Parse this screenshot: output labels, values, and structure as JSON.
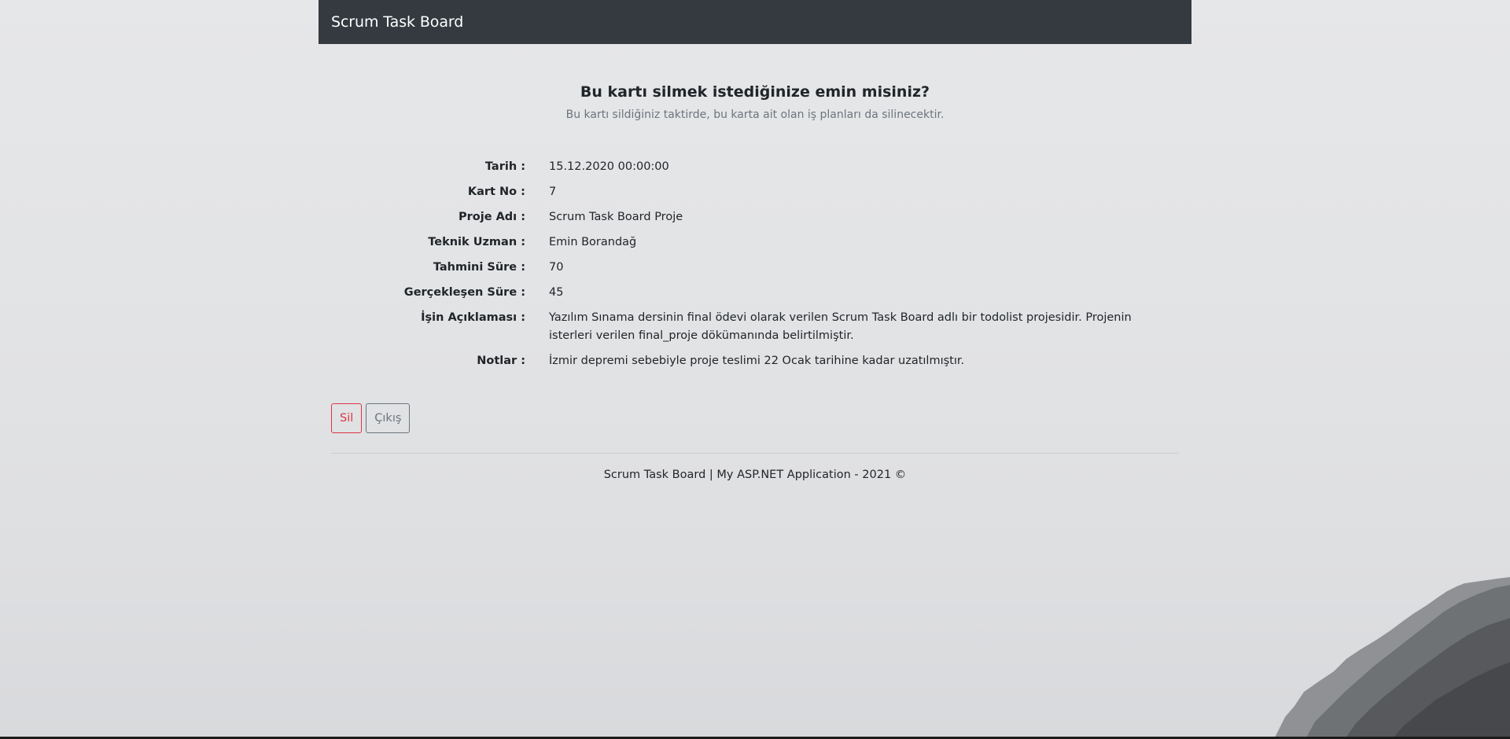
{
  "navbar": {
    "brand": "Scrum Task Board"
  },
  "confirm": {
    "title": "Bu kartı silmek istediğinize emin misiniz?",
    "subtitle": "Bu kartı sildiğiniz taktirde, bu karta ait olan iş planları da silinecektir."
  },
  "details": [
    {
      "label": "Tarih :",
      "value": "15.12.2020 00:00:00"
    },
    {
      "label": "Kart No :",
      "value": "7"
    },
    {
      "label": "Proje Adı :",
      "value": "Scrum Task Board Proje"
    },
    {
      "label": "Teknik Uzman :",
      "value": "Emin Borandağ"
    },
    {
      "label": "Tahmini Süre :",
      "value": "70"
    },
    {
      "label": "Gerçekleşen Süre :",
      "value": "45"
    },
    {
      "label": "İşin Açıklaması :",
      "value": "Yazılım Sınama dersinin final ödevi olarak verilen Scrum Task Board adlı bir todolist projesidir. Projenin isterleri verilen final_proje dökümanında belirtilmiştir."
    },
    {
      "label": "Notlar :",
      "value": "İzmir depremi sebebiyle proje teslimi 22 Ocak tarihine kadar uzatılmıştır."
    }
  ],
  "actions": {
    "delete_label": "Sil",
    "exit_label": "Çıkış",
    "delete_color": "#dc3545",
    "exit_color": "#6c757d"
  },
  "footer": {
    "text": "Scrum Task Board | My ASP.NET Application - 2021 ©"
  },
  "colors": {
    "navbar_bg": "#343a40",
    "page_bg": "#e4e5e7"
  }
}
